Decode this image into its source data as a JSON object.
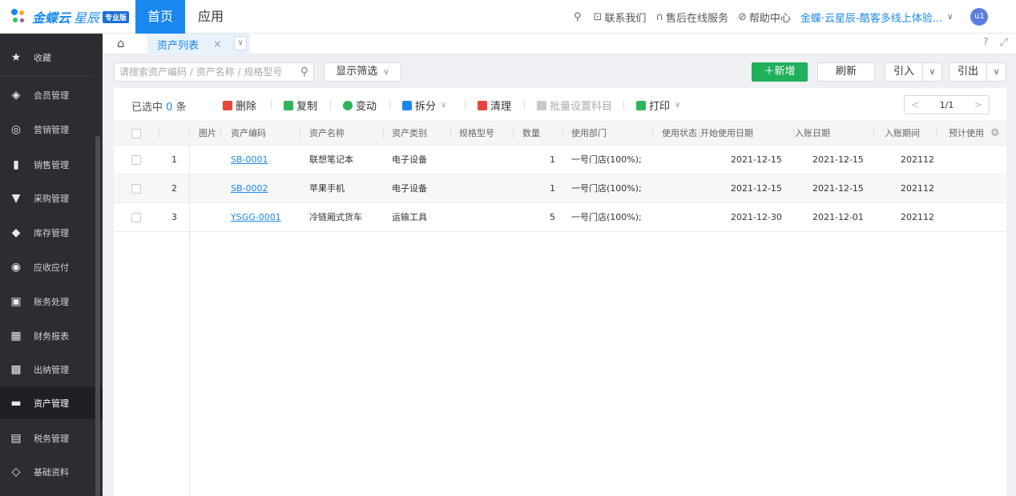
{
  "header": {
    "logo_text": "金蝶云",
    "logo_sub": "星辰",
    "logo_badge": "专业版",
    "nav_home": "首页",
    "nav_app": "应用",
    "contact": "联系我们",
    "service": "售后在线服务",
    "help": "帮助中心",
    "account": "金蝶·云星辰-酷客多线上体验...",
    "avatar": "u1"
  },
  "sidebar": {
    "items": [
      {
        "label": "收藏",
        "icon": "star-icon"
      },
      {
        "label": "会员管理",
        "icon": "diamond-icon"
      },
      {
        "label": "营销管理",
        "icon": "target-icon"
      },
      {
        "label": "销售管理",
        "icon": "bar-chart-icon"
      },
      {
        "label": "采购管理",
        "icon": "cart-icon"
      },
      {
        "label": "库存管理",
        "icon": "box-icon"
      },
      {
        "label": "应收应付",
        "icon": "coin-icon"
      },
      {
        "label": "账务处理",
        "icon": "ledger-icon"
      },
      {
        "label": "财务报表",
        "icon": "report-icon"
      },
      {
        "label": "出纳管理",
        "icon": "cashier-icon"
      },
      {
        "label": "资产管理",
        "icon": "asset-icon"
      },
      {
        "label": "税务管理",
        "icon": "tax-icon"
      },
      {
        "label": "基础资料",
        "icon": "layers-icon"
      }
    ]
  },
  "tabs": {
    "active": "资产列表",
    "close": "×"
  },
  "search": {
    "placeholder": "请搜索资产编码 / 资产名称 / 规格型号",
    "filter": "显示筛选"
  },
  "actions": {
    "add": "新增",
    "refresh": "刷新",
    "import": "引入",
    "export": "引出"
  },
  "toolbar": {
    "selected_prefix": "已选中",
    "selected_count": "0",
    "selected_suffix": "条",
    "delete": "删除",
    "copy": "复制",
    "change": "变动",
    "split": "拆分",
    "clean": "清理",
    "batch": "批量设置科目",
    "print": "打印",
    "page": "1/1"
  },
  "table": {
    "columns": [
      "图片",
      "资产编码",
      "资产名称",
      "资产类别",
      "规格型号",
      "数量",
      "使用部门",
      "使用状态",
      "开始使用日期",
      "入账日期",
      "入账期间",
      "预计使用"
    ],
    "rows": [
      {
        "idx": "1",
        "code": "SB-0001",
        "name": "联想笔记本",
        "category": "电子设备",
        "spec": "",
        "qty": "1",
        "dept": "一号门店(100%);",
        "status": "",
        "start": "2021-12-15",
        "entry": "2021-12-15",
        "period": "202112"
      },
      {
        "idx": "2",
        "code": "SB-0002",
        "name": "苹果手机",
        "category": "电子设备",
        "spec": "",
        "qty": "1",
        "dept": "一号门店(100%);",
        "status": "",
        "start": "2021-12-15",
        "entry": "2021-12-15",
        "period": "202112"
      },
      {
        "idx": "3",
        "code": "YSGG-0001",
        "name": "冷链厢式货车",
        "category": "运输工具",
        "spec": "",
        "qty": "5",
        "dept": "一号门店(100%);",
        "status": "",
        "start": "2021-12-30",
        "entry": "2021-12-01",
        "period": "202112"
      }
    ]
  }
}
